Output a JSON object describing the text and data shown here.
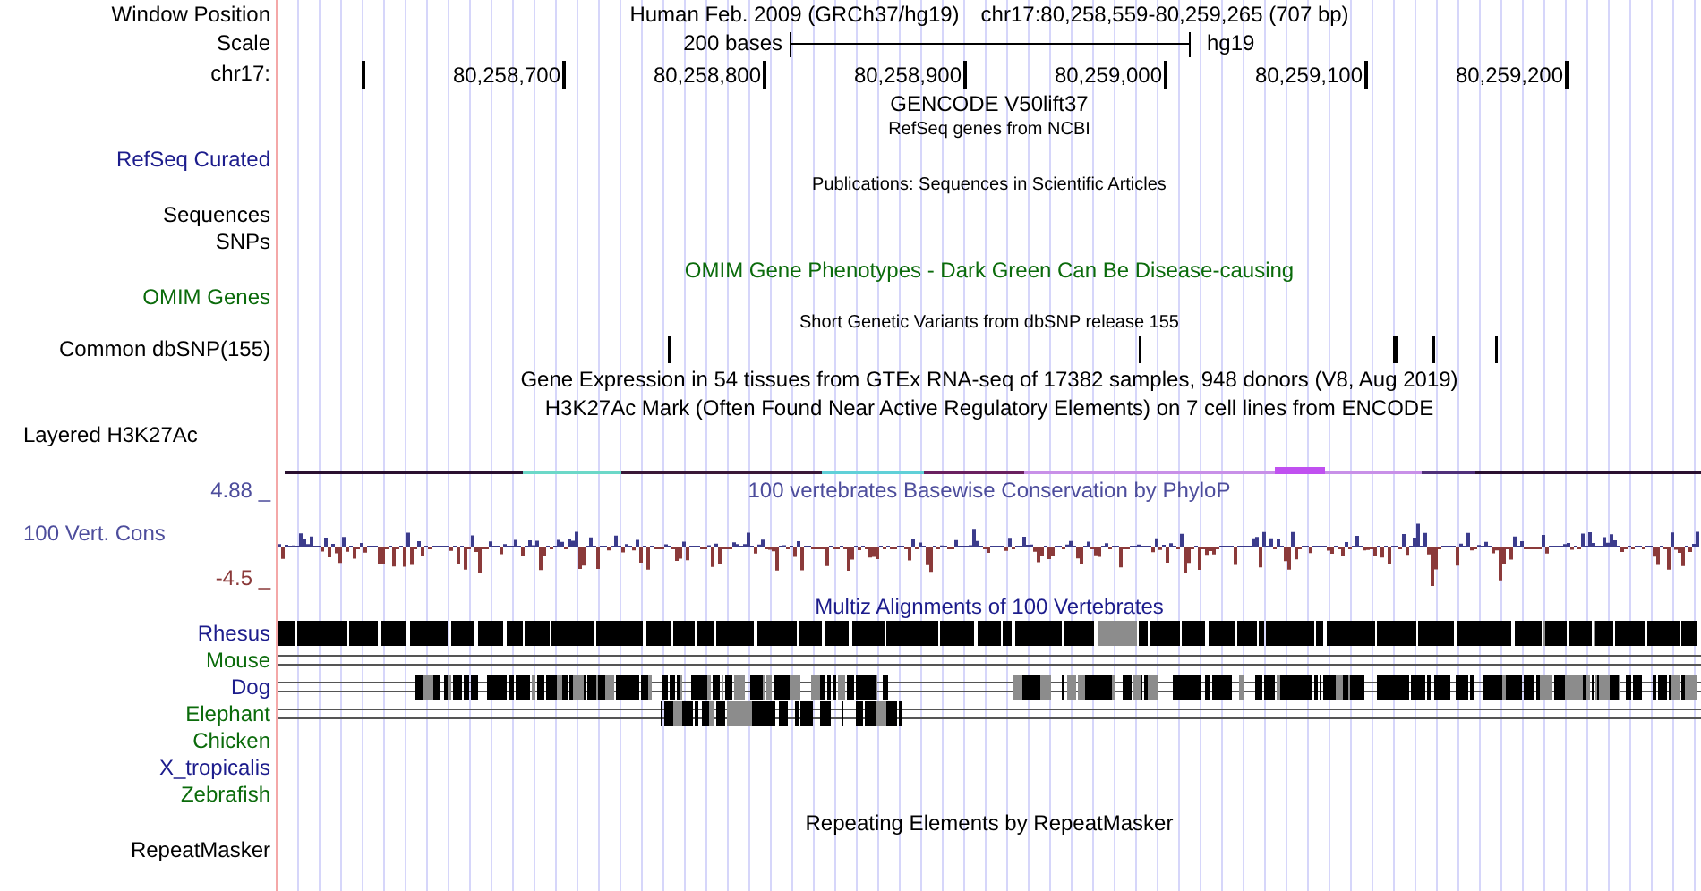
{
  "window_position": {
    "label": "Window Position",
    "assembly": "Human Feb. 2009 (GRCh37/hg19)",
    "position": "chr17:80,258,559-80,259,265 (707 bp)"
  },
  "scale": {
    "label": "Scale",
    "length": "200 bases",
    "assembly": "hg19"
  },
  "ruler": {
    "label": "chr17:",
    "ticks": [
      "80,258,700",
      "80,258,800",
      "80,258,900",
      "80,259,000",
      "80,259,100",
      "80,259,200"
    ]
  },
  "tracks": [
    {
      "kind": "heading",
      "title": {
        "text": "GENCODE V50lift37",
        "color": "#000000"
      }
    },
    {
      "kind": "annotation",
      "title": {
        "text": "RefSeq genes from NCBI",
        "color": "#000000"
      },
      "labels": [
        "RefSeq Curated"
      ],
      "color": "#1c1c8c"
    },
    {
      "kind": "annotation",
      "title": {
        "text": "Publications: Sequences in Scientific Articles",
        "color": "#000000"
      },
      "labels": [
        "Sequences",
        "SNPs"
      ],
      "color": "#000000"
    },
    {
      "kind": "feature",
      "title": {
        "text": "OMIM Gene Phenotypes - Dark Green Can Be Disease-causing",
        "color": "#0b6b0b"
      },
      "labels": [
        "OMIM Genes"
      ],
      "color": "#0b6b0b"
    },
    {
      "kind": "snp",
      "title": {
        "text": "Short Genetic Variants from dbSNP release 155",
        "color": "#000000"
      },
      "labels": [
        "Common dbSNP(155)"
      ],
      "color": "#000000"
    },
    {
      "kind": "heading",
      "title": {
        "text": "Gene Expression in 54 tissues from GTEx RNA-seq of 17382 samples, 948 donors (V8, Aug 2019)",
        "color": "#000000"
      }
    },
    {
      "kind": "layered",
      "title": {
        "text": "H3K27Ac Mark (Often Found Near Active Regulatory Elements) on 7 cell lines from ENCODE",
        "color": "#000000"
      },
      "labels": [
        "Layered H3K27Ac"
      ],
      "color": "#000000"
    },
    {
      "kind": "wiggle",
      "title": {
        "text": "100 vertebrates Basewise Conservation by PhyloP",
        "color": "#4d4d9c"
      },
      "labels": [
        "100 Vert. Cons"
      ],
      "color": "#4d4d9c",
      "max_label": "4.88 _",
      "min_label": "-4.5 _"
    },
    {
      "kind": "alignment",
      "title": {
        "text": "Multiz Alignments of 100 Vertebrates",
        "color": "#1c1c8c"
      },
      "species": [
        {
          "name": "Rhesus",
          "color": "#1c1c8c",
          "kind": "full"
        },
        {
          "name": "Mouse",
          "color": "#0b6b0b",
          "kind": "lines"
        },
        {
          "name": "Dog",
          "color": "#1c1c8c",
          "kind": "partial"
        },
        {
          "name": "Elephant",
          "color": "#0b6b0b",
          "kind": "partial"
        },
        {
          "name": "Chicken",
          "color": "#0b6b0b",
          "kind": "empty"
        },
        {
          "name": "X_tropicalis",
          "color": "#1c1c8c",
          "kind": "empty"
        },
        {
          "name": "Zebrafish",
          "color": "#0b6b0b",
          "kind": "empty"
        }
      ]
    },
    {
      "kind": "feature",
      "title": {
        "text": "Repeating Elements by RepeatMasker",
        "color": "#000000"
      },
      "labels": [
        "RepeatMasker"
      ],
      "color": "#000000"
    }
  ]
}
